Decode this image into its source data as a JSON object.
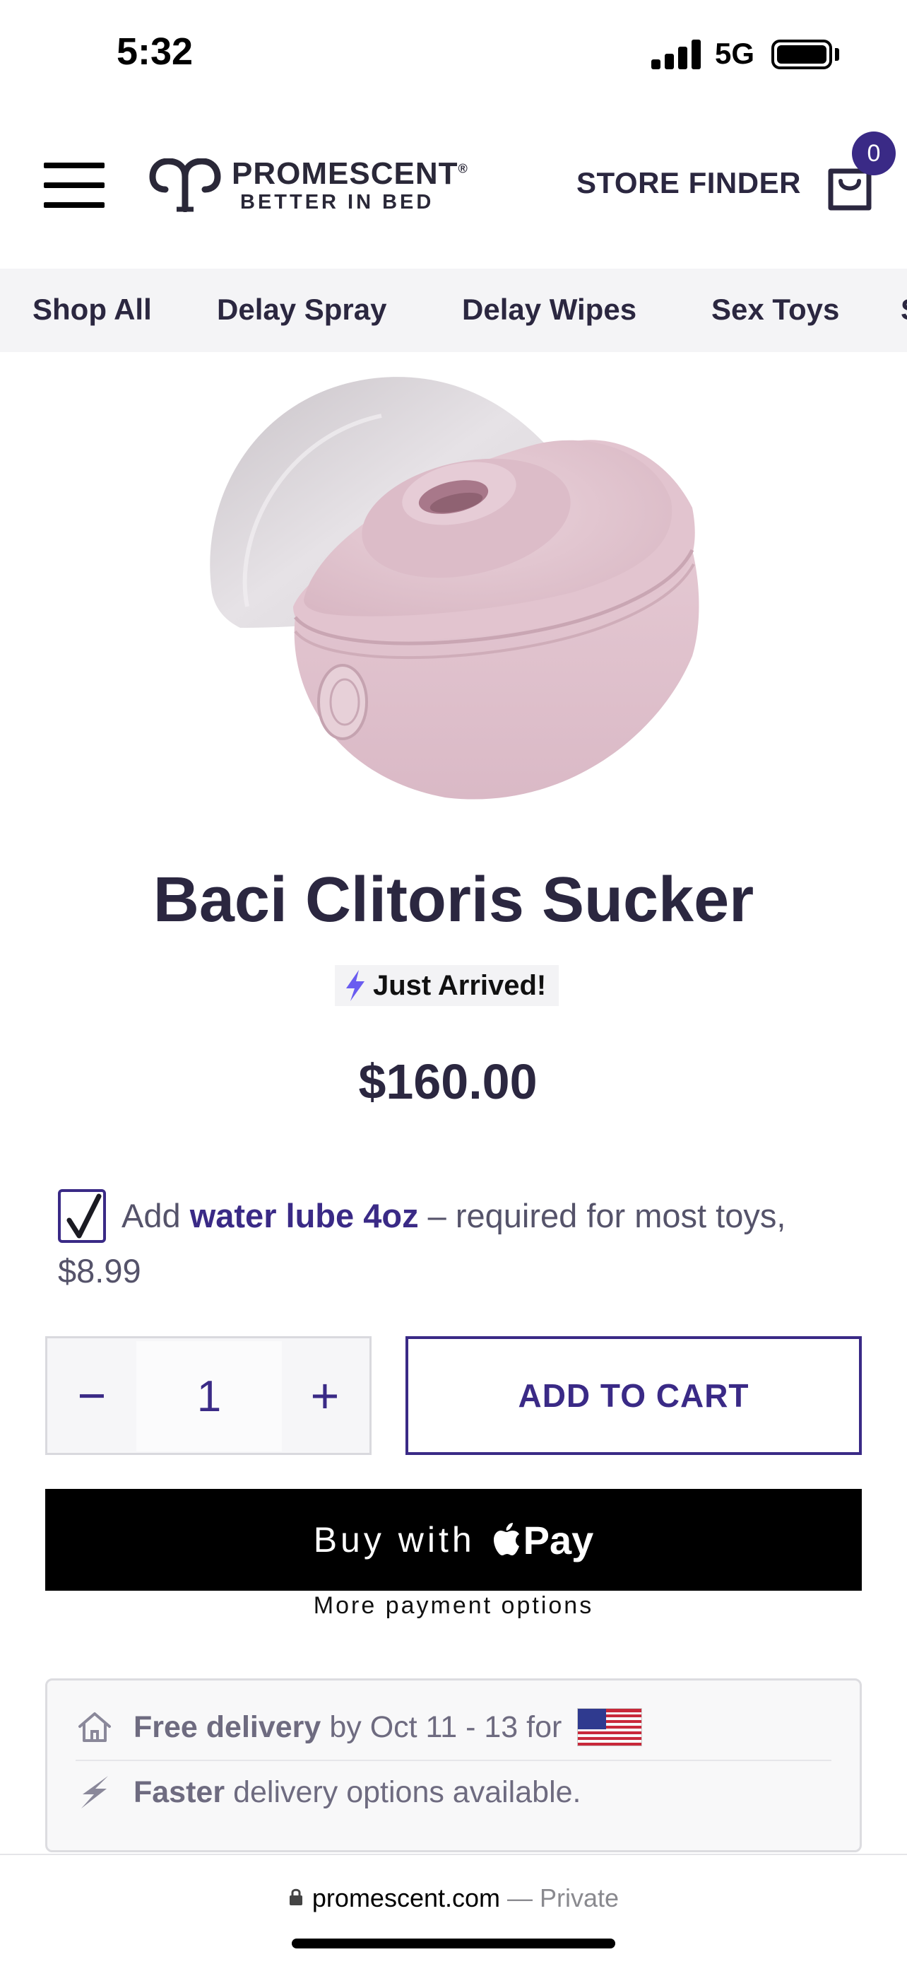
{
  "status_bar": {
    "time": "5:32",
    "network": "5G"
  },
  "header": {
    "logo": {
      "brand": "PROMESCENT",
      "trademark": "®",
      "tagline": "BETTER IN BED"
    },
    "store_finder": "STORE FINDER",
    "cart_count": "0"
  },
  "category_nav": {
    "items": [
      "Shop All",
      "Delay Spray",
      "Delay Wipes",
      "Sex Toys",
      "S"
    ]
  },
  "product": {
    "image_alt": "Pink clitoral suction device with frosted lid",
    "title": "Baci Clitoris Sucker",
    "badge": "Just Arrived!",
    "price": "$160.00"
  },
  "addon": {
    "checked": true,
    "prefix": "Add",
    "link_text": "water lube 4oz",
    "suffix": "– required for most toys, $8.99"
  },
  "purchase": {
    "quantity": "1",
    "minus_symbol": "−",
    "plus_symbol": "+",
    "add_to_cart": "ADD TO CART",
    "apple_pay_prefix": "Buy with",
    "apple_pay_brand": "Pay",
    "more_payment_options": "More payment options"
  },
  "delivery": {
    "row1_bold": "Free delivery",
    "row1_text": "by Oct 11 - 13 for",
    "row2_bold": "Faster",
    "row2_text": "delivery options available."
  },
  "url_bar": {
    "domain": "promescent.com",
    "privacy": "— Private"
  },
  "colors": {
    "brand_purple": "#3a2a86",
    "text_dark": "#2b2740",
    "badge_bolt": "#6a5cf0"
  }
}
